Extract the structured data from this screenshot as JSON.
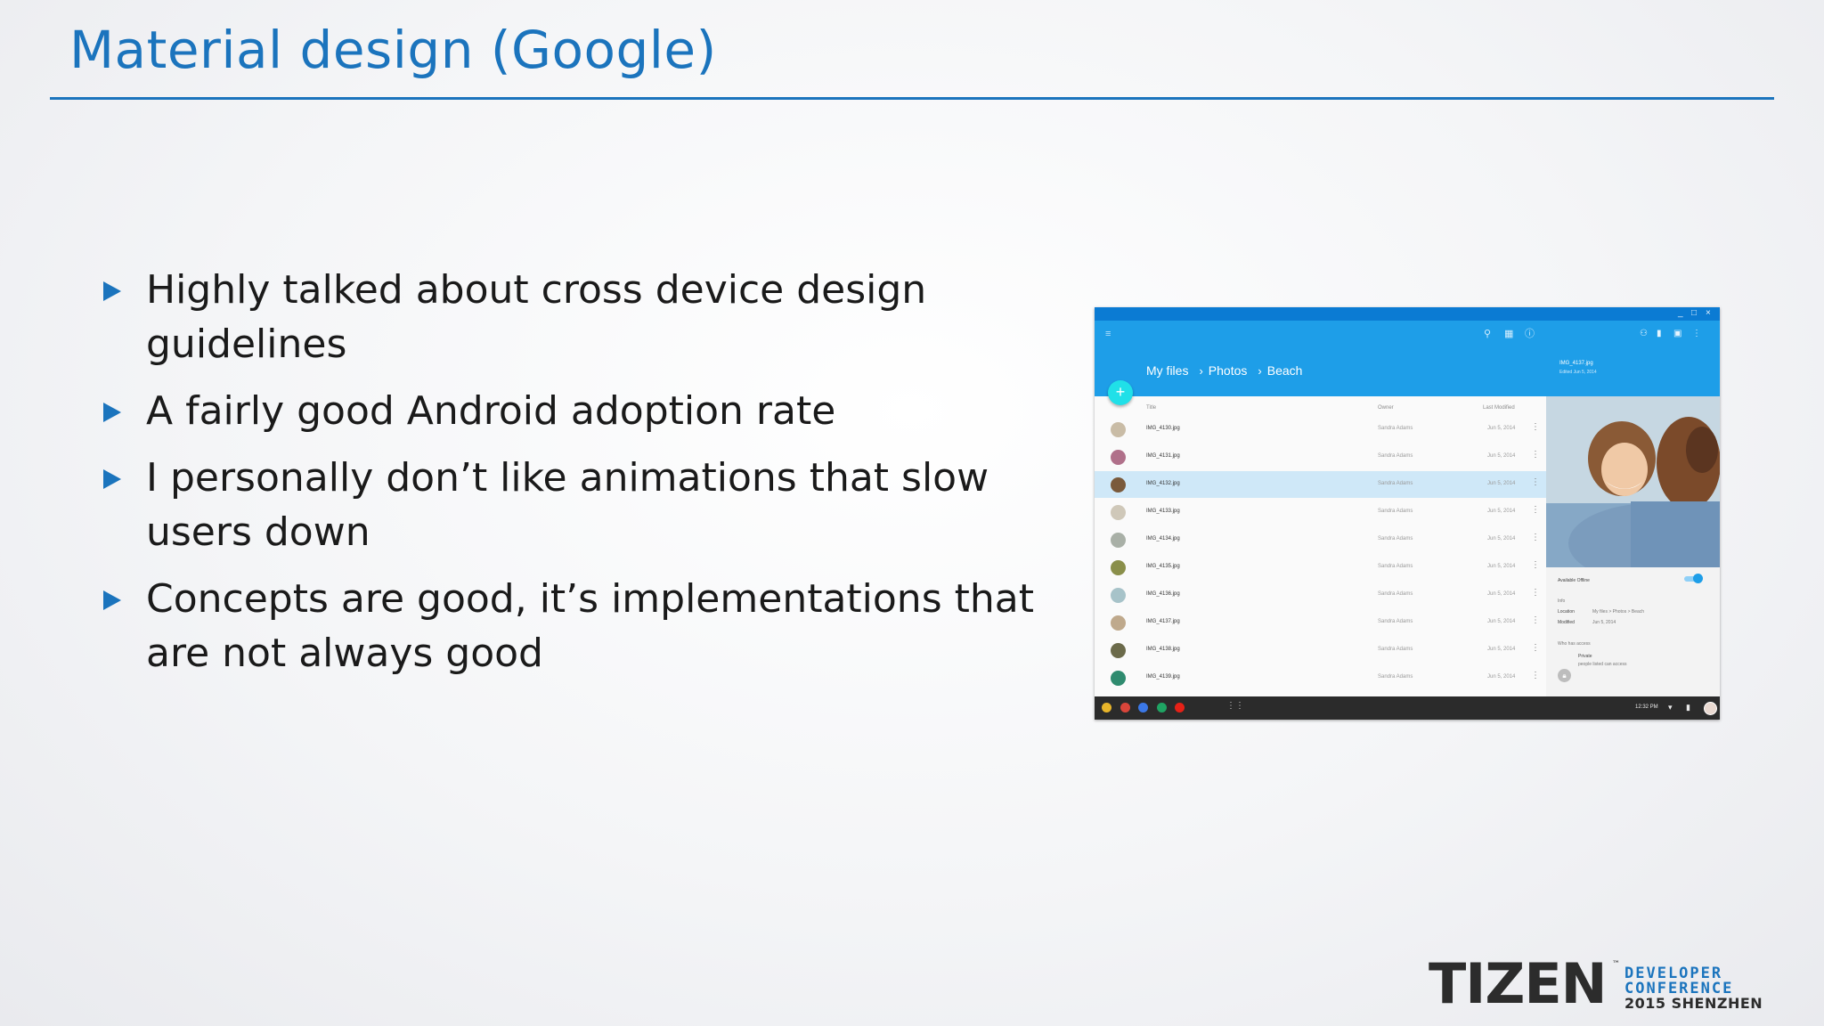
{
  "slide": {
    "title": "Material design (Google)",
    "bullets": [
      "Highly talked about cross device design guidelines",
      "A fairly good Android adoption rate",
      "I personally don’t like animations that slow users down",
      "Concepts are good, it’s implementations that are not always good"
    ]
  },
  "screenshot": {
    "window_controls": [
      "_",
      "□",
      "×"
    ],
    "header_icons": [
      "menu-icon",
      "search-icon",
      "grid-view-icon",
      "info-icon"
    ],
    "breadcrumb": [
      "My files",
      "Photos",
      "Beach"
    ],
    "breadcrumb_separator": "›",
    "fab_label": "+",
    "columns": {
      "title": "Title",
      "owner": "Owner",
      "modified": "Last Modified"
    },
    "files": [
      {
        "name": "IMG_4130.jpg",
        "owner": "Sandra Adams",
        "date": "Jun 5, 2014",
        "color": "#c9bca6"
      },
      {
        "name": "IMG_4131.jpg",
        "owner": "Sandra Adams",
        "date": "Jun 5, 2014",
        "color": "#b0708a"
      },
      {
        "name": "IMG_4132.jpg",
        "owner": "Sandra Adams",
        "date": "Jun 5, 2014",
        "color": "#7a5a3c"
      },
      {
        "name": "IMG_4133.jpg",
        "owner": "Sandra Adams",
        "date": "Jun 5, 2014",
        "color": "#cfc8b9"
      },
      {
        "name": "IMG_4134.jpg",
        "owner": "Sandra Adams",
        "date": "Jun 5, 2014",
        "color": "#a9b0a7"
      },
      {
        "name": "IMG_4135.jpg",
        "owner": "Sandra Adams",
        "date": "Jun 5, 2014",
        "color": "#8a8f4a"
      },
      {
        "name": "IMG_4136.jpg",
        "owner": "Sandra Adams",
        "date": "Jun 5, 2014",
        "color": "#a7c3c9"
      },
      {
        "name": "IMG_4137.jpg",
        "owner": "Sandra Adams",
        "date": "Jun 5, 2014",
        "color": "#bfa98c"
      },
      {
        "name": "IMG_4138.jpg",
        "owner": "Sandra Adams",
        "date": "Jun 5, 2014",
        "color": "#6b6a4a"
      },
      {
        "name": "IMG_4139.jpg",
        "owner": "Sandra Adams",
        "date": "Jun 5, 2014",
        "color": "#2f8b6f"
      }
    ],
    "selected_index": 2,
    "detail": {
      "header_icons": [
        "add-person-icon",
        "delete-icon",
        "folder-icon",
        "more-icon"
      ],
      "file_name": "IMG_4137.jpg",
      "edited": "Edited Jun 5, 2014",
      "available_offline_label": "Available Offline",
      "available_offline": true,
      "info_label": "Info",
      "location_label": "Location",
      "location_value": "My files  >  Photos  >  Beach",
      "modified_label": "Modified",
      "modified_value": "Jun 5, 2014",
      "access_label": "Who has access",
      "privacy_title": "Private",
      "privacy_desc": "people listed can access"
    },
    "shelf": {
      "apps": [
        {
          "name": "chrome-icon",
          "color": "#e8b52a"
        },
        {
          "name": "gmail-icon",
          "color": "#d9453a"
        },
        {
          "name": "search-app-icon",
          "color": "#3b78e7"
        },
        {
          "name": "drive-icon",
          "color": "#1fa463"
        },
        {
          "name": "youtube-icon",
          "color": "#e62117"
        }
      ],
      "clock": "12:32 PM"
    },
    "colors": {
      "primary": "#1e9ee8",
      "accent": "#20e0e8",
      "selected_row": "#cfe8f8",
      "shelf": "#2b2b2b"
    }
  },
  "logo": {
    "main": "TIZEN",
    "tm": "™",
    "line1": "DEVELOPER",
    "line2": "CONFERENCE",
    "line3": "2015 SHENZHEN"
  },
  "colors": {
    "accent": "#1b74bd",
    "text": "#1a1a1a"
  }
}
